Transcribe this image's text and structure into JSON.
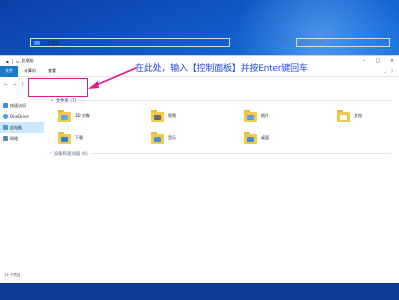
{
  "window": {
    "title": "此电脑"
  },
  "ribbon": {
    "tabs": [
      "文件",
      "计算机",
      "查看"
    ]
  },
  "address": {
    "path": "此电脑",
    "search_placeholder": "搜索\"此电脑\""
  },
  "sidebar": {
    "items": [
      "快速访问",
      "OneDrive",
      "此电脑",
      "网络"
    ]
  },
  "folders_group": {
    "title": "文件夹 (7)"
  },
  "folders": [
    {
      "name": "3D 对象",
      "icon": "3d-objects-icon",
      "color": "#5fa7e8"
    },
    {
      "name": "视频",
      "icon": "video-icon",
      "color": "#6b6b6b"
    },
    {
      "name": "图片",
      "icon": "pictures-icon",
      "color": "#5aa0d6"
    },
    {
      "name": "文档",
      "icon": "documents-icon",
      "color": "#ffffff"
    },
    {
      "name": "下载",
      "icon": "download-icon",
      "color": "#2a7fd4"
    },
    {
      "name": "音乐",
      "icon": "music-icon",
      "color": "#4a8fd0"
    },
    {
      "name": "桌面",
      "icon": "desktop-icon",
      "color": "#3c8fd8"
    }
  ],
  "devices_group": {
    "title": "设备和驱动器 (6)"
  },
  "status": {
    "text": "13 个项目"
  },
  "annotation": {
    "text": "在此处，输入【控制面板】并按Enter键回车",
    "color": "#1a49d8",
    "highlight_color": "#e0198f"
  }
}
